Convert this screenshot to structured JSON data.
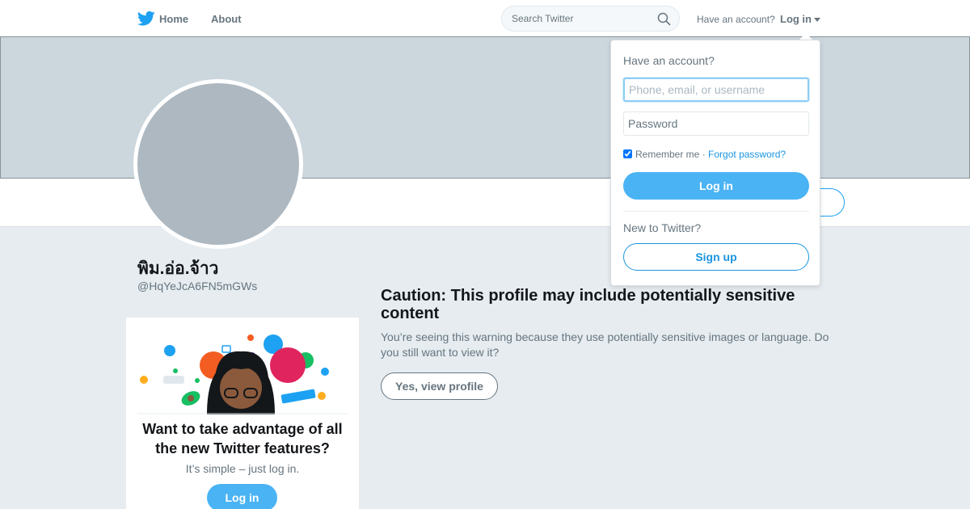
{
  "nav": {
    "home_label": "Home",
    "about_label": "About",
    "search_placeholder": "Search Twitter",
    "have_account_text": "Have an account?",
    "login_label": "Log in",
    "brand_color": "#1da1f2",
    "logo_icon": "twitter-bird-icon",
    "search_icon": "search-icon"
  },
  "profile": {
    "display_name": "พิม.อ่อ.จ้าว",
    "handle": "@HqYeJcA6FN5mGWs",
    "banner_color": "#ccd6dd",
    "avatar_color": "#adb8c1"
  },
  "promo": {
    "title": "Want to take advantage of all the new Twitter features?",
    "subtitle": "It’s simple – just log in.",
    "login_label": "Log in"
  },
  "caution": {
    "title": "Caution: This profile may include potentially sensitive content",
    "description": "You’re seeing this warning because they use potentially sensitive images or language. Do you still want to view it?",
    "view_button": "Yes, view profile"
  },
  "login_dropdown": {
    "heading": "Have an account?",
    "username_placeholder": "Phone, email, or username",
    "password_placeholder": "Password",
    "remember_label": "Remember me",
    "separator": "·",
    "forgot_label": "Forgot password?",
    "remember_checked": true,
    "login_button": "Log in",
    "new_text": "New to Twitter?",
    "signup_button": "Sign up"
  }
}
